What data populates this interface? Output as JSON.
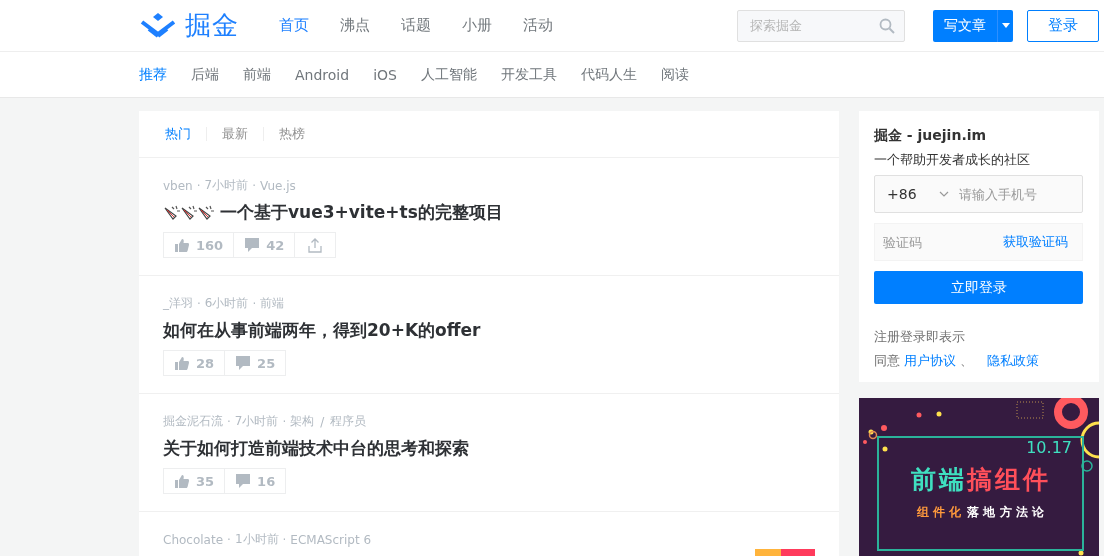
{
  "header": {
    "logo_text": "掘金",
    "nav": [
      {
        "label": "首页",
        "selected": true
      },
      {
        "label": "沸点",
        "selected": false
      },
      {
        "label": "话题",
        "selected": false
      },
      {
        "label": "小册",
        "selected": false
      },
      {
        "label": "活动",
        "selected": false
      }
    ],
    "search": {
      "placeholder": "探索掘金"
    },
    "write_button": "写文章",
    "login_button": "登录"
  },
  "categories": [
    {
      "label": "推荐",
      "selected": true
    },
    {
      "label": "后端",
      "selected": false
    },
    {
      "label": "前端",
      "selected": false
    },
    {
      "label": "Android",
      "selected": false
    },
    {
      "label": "iOS",
      "selected": false
    },
    {
      "label": "人工智能",
      "selected": false
    },
    {
      "label": "开发工具",
      "selected": false
    },
    {
      "label": "代码人生",
      "selected": false
    },
    {
      "label": "阅读",
      "selected": false
    }
  ],
  "sort_tabs": [
    {
      "label": "热门",
      "selected": true
    },
    {
      "label": "最新",
      "selected": false
    },
    {
      "label": "热榜",
      "selected": false
    }
  ],
  "articles": [
    {
      "meta": [
        {
          "kind": "author",
          "text": "vben"
        },
        {
          "kind": "dot",
          "text": "·"
        },
        {
          "kind": "time",
          "text": "7小时前"
        },
        {
          "kind": "dot",
          "text": "·"
        },
        {
          "kind": "tag",
          "text": "Vue.js"
        }
      ],
      "title_prefix_icons": true,
      "title": "一个基于vue3+vite+ts的完整项目",
      "likes": "160",
      "comments": "42",
      "share": true
    },
    {
      "meta": [
        {
          "kind": "author",
          "text": "_洋羽"
        },
        {
          "kind": "dot",
          "text": "·"
        },
        {
          "kind": "time",
          "text": "6小时前"
        },
        {
          "kind": "dot",
          "text": "·"
        },
        {
          "kind": "tag",
          "text": "前端"
        }
      ],
      "title_prefix_icons": false,
      "title": "如何在从事前端两年，得到20+K的offer",
      "likes": "28",
      "comments": "25",
      "share": false
    },
    {
      "meta": [
        {
          "kind": "author",
          "text": "掘金泥石流"
        },
        {
          "kind": "dot",
          "text": "·"
        },
        {
          "kind": "time",
          "text": "7小时前"
        },
        {
          "kind": "dot",
          "text": "·"
        },
        {
          "kind": "tag",
          "text": "架构"
        },
        {
          "kind": "slash",
          "text": "/"
        },
        {
          "kind": "tag",
          "text": "程序员"
        }
      ],
      "title_prefix_icons": false,
      "title": "关于如何打造前端技术中台的思考和探索",
      "likes": "35",
      "comments": "16",
      "share": false
    },
    {
      "meta": [
        {
          "kind": "author",
          "text": "Chocolate"
        },
        {
          "kind": "dot",
          "text": "·"
        },
        {
          "kind": "time",
          "text": "1小时前"
        },
        {
          "kind": "dot",
          "text": "·"
        },
        {
          "kind": "tag",
          "text": "ECMAScript 6"
        }
      ]
    }
  ],
  "login_card": {
    "title": "掘金 - juejin.im",
    "subtitle": "一个帮助开发者成长的社区",
    "country_code": "+86",
    "phone_placeholder": "请输入手机号",
    "code_placeholder": "验证码",
    "get_code": "获取验证码",
    "submit": "立即登录",
    "notice": "注册登录即表示",
    "agree": "同意",
    "terms": "用户协议",
    "separator": "、",
    "privacy": "隐私政策"
  },
  "banner": {
    "date": "10.17",
    "headline_a": "前端",
    "headline_b": "搞组件",
    "sub_a": "组 件 化",
    "sub_b": "落 地 方 法 论"
  }
}
